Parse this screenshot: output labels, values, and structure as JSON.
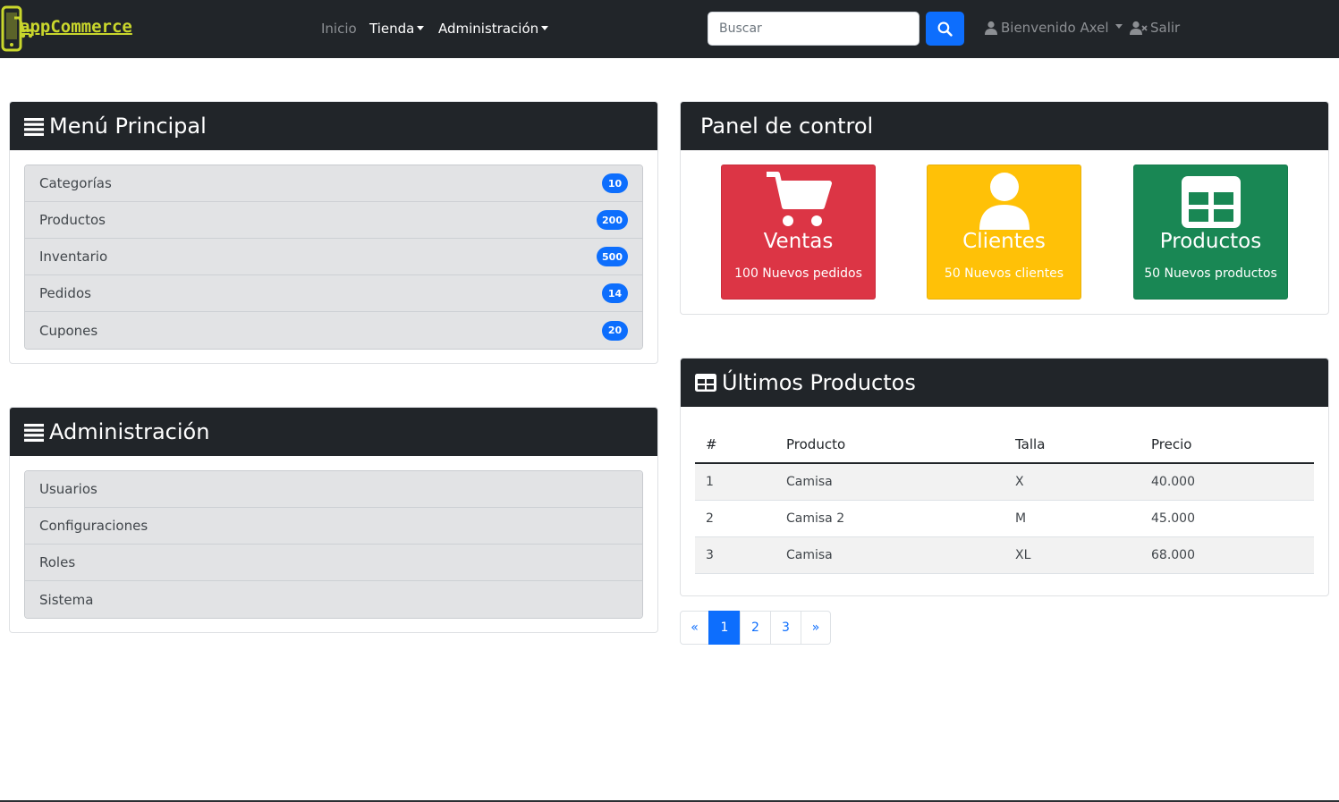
{
  "navbar": {
    "brand": "appCommerce",
    "links": [
      {
        "label": "Inicio"
      },
      {
        "label": "Tienda"
      },
      {
        "label": "Administración"
      }
    ],
    "search": {
      "placeholder": "Buscar",
      "value": ""
    },
    "user_label": "Bienvenido Axel",
    "logout_label": "Salir"
  },
  "menu_principal": {
    "title": "Menú Principal",
    "items": [
      {
        "label": "Categorías",
        "count": "10"
      },
      {
        "label": "Productos",
        "count": "200"
      },
      {
        "label": "Inventario",
        "count": "500"
      },
      {
        "label": "Pedidos",
        "count": "14"
      },
      {
        "label": "Cupones",
        "count": "20"
      }
    ]
  },
  "administracion": {
    "title": "Administración",
    "items": [
      {
        "label": "Usuarios"
      },
      {
        "label": "Configuraciones"
      },
      {
        "label": "Roles"
      },
      {
        "label": "Sistema"
      }
    ]
  },
  "panel": {
    "title": "Panel de control",
    "tiles": [
      {
        "title": "Ventas",
        "subtitle": "100 Nuevos pedidos",
        "color": "#dc3545",
        "icon": "shopping-cart-icon"
      },
      {
        "title": "Clientes",
        "subtitle": "50 Nuevos clientes",
        "color": "#ffc107",
        "icon": "user-icon"
      },
      {
        "title": "Productos",
        "subtitle": "50 Nuevos productos",
        "color": "#198754",
        "icon": "table-icon"
      }
    ]
  },
  "ultimos_productos": {
    "title": "Últimos Productos",
    "columns": [
      "#",
      "Producto",
      "Talla",
      "Precio"
    ],
    "rows": [
      [
        "1",
        "Camisa",
        "X",
        "40.000"
      ],
      [
        "2",
        "Camisa 2",
        "M",
        "45.000"
      ],
      [
        "3",
        "Camisa",
        "XL",
        "68.000"
      ]
    ]
  },
  "pagination": {
    "prev": "«",
    "pages": [
      "1",
      "2",
      "3"
    ],
    "next": "»",
    "active": "1"
  },
  "colors": {
    "navbar": "#212529",
    "primary": "#0d6efd",
    "danger": "#dc3545",
    "warning": "#ffc107",
    "success": "#198754"
  }
}
